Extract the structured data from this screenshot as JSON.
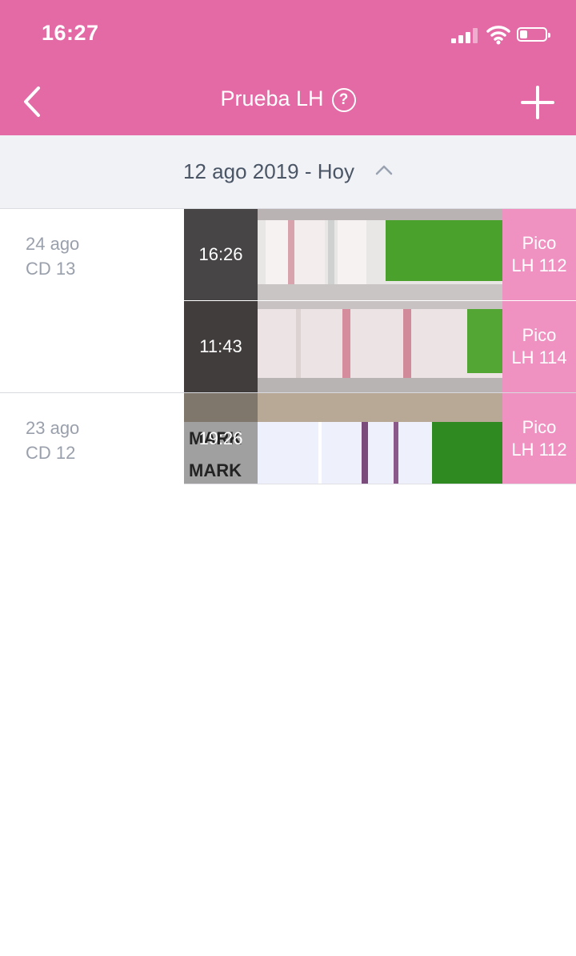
{
  "status_bar": {
    "time": "16:27"
  },
  "nav": {
    "title": "Prueba LH",
    "help_symbol": "?"
  },
  "date_range": {
    "label": "12 ago 2019 - Hoy"
  },
  "days": [
    {
      "date": "24 ago",
      "cycle_day": "CD 13",
      "entries": [
        {
          "time": "16:26",
          "result_label": "Pico",
          "result_value": "LH 112"
        },
        {
          "time": "11:43",
          "result_label": "Pico",
          "result_value": "LH 114"
        }
      ]
    },
    {
      "date": "23 ago",
      "cycle_day": "CD 12",
      "entries": [
        {
          "time": "19:26",
          "result_label": "Pico",
          "result_value": "LH 112",
          "strip_text": [
            "MARK",
            "MARK"
          ]
        }
      ]
    }
  ],
  "colors": {
    "header": "#e46aa6",
    "result_badge": "#ef92c1",
    "range_bg": "#f1f2f6"
  },
  "icons": [
    "back-chevron-icon",
    "help-circle-icon",
    "plus-icon",
    "chevron-up-icon",
    "signal-icon",
    "wifi-icon",
    "battery-icon"
  ]
}
